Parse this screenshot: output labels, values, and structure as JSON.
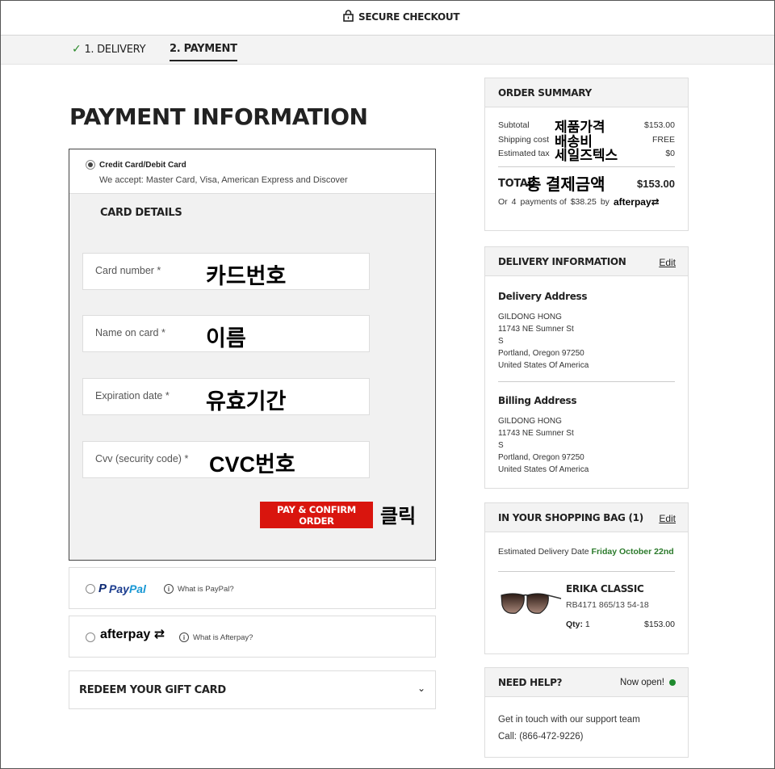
{
  "header": {
    "title": "SECURE CHECKOUT"
  },
  "steps": [
    {
      "label": "1. DELIVERY",
      "done": true
    },
    {
      "label": "2. PAYMENT",
      "active": true
    }
  ],
  "payment": {
    "title": "PAYMENT INFORMATION",
    "credit_card": {
      "label": "Credit Card/Debit Card",
      "accepts": "We accept: Master Card, Visa, American Express and Discover",
      "details_title": "CARD DETAILS",
      "fields": [
        {
          "label": "Card number *",
          "note": "카드번호"
        },
        {
          "label": "Name on card *",
          "note": "이름"
        },
        {
          "label": "Expiration date *",
          "note": "유효기간"
        },
        {
          "label": "Cvv (security code) *",
          "note": "CVC번호"
        }
      ],
      "pay_button": "PAY & CONFIRM ORDER",
      "click_note": "클릭"
    },
    "paypal": {
      "logo_mark": "P",
      "logo_text_a": "Pay",
      "logo_text_b": "Pal",
      "info": "What is PayPal?"
    },
    "afterpay": {
      "logo": "afterpay",
      "info": "What is Afterpay?"
    },
    "gift_card": {
      "label": "REDEEM YOUR GIFT CARD"
    }
  },
  "summary": {
    "title": "ORDER SUMMARY",
    "rows": [
      {
        "label": "Subtotal",
        "note": "제품가격",
        "value": "$153.00"
      },
      {
        "label": "Shipping cost",
        "note": "배송비",
        "value": "FREE"
      },
      {
        "label": "Estimated tax",
        "note": "세일즈텍스",
        "value": "$0"
      }
    ],
    "total_label": "TOTAL",
    "total_note": "총 결제금액",
    "total_value": "$153.00",
    "installment_prefix": "Or",
    "installment_count": "4",
    "installment_mid": "payments of",
    "installment_amount": "$38.25",
    "installment_by": "by",
    "installment_brand": "afterpay"
  },
  "delivery": {
    "title": "DELIVERY INFORMATION",
    "edit": "Edit",
    "delivery_address": {
      "title": "Delivery Address",
      "lines": [
        "GILDONG HONG",
        "11743 NE Sumner St",
        "S",
        "Portland, Oregon 97250",
        "United States Of America"
      ]
    },
    "billing_address": {
      "title": "Billing Address",
      "lines": [
        "GILDONG HONG",
        "11743 NE Sumner St",
        "S",
        "Portland, Oregon 97250",
        "United States Of America"
      ]
    }
  },
  "bag": {
    "title": "IN YOUR SHOPPING BAG (1)",
    "edit": "Edit",
    "est_label": "Estimated Delivery Date",
    "est_date": "Friday October 22nd",
    "product": {
      "name": "ERIKA CLASSIC",
      "sku": "RB4171 865/13 54-18",
      "qty_label": "Qty:",
      "qty": "1",
      "price": "$153.00"
    }
  },
  "help": {
    "title": "NEED HELP?",
    "status": "Now open!",
    "text": "Get in touch with our support team",
    "call": "Call: (866-472-9226)"
  },
  "colors": {
    "accent": "#d9150e",
    "success": "#2b7a2b",
    "status_dot": "#1e8a2e"
  }
}
